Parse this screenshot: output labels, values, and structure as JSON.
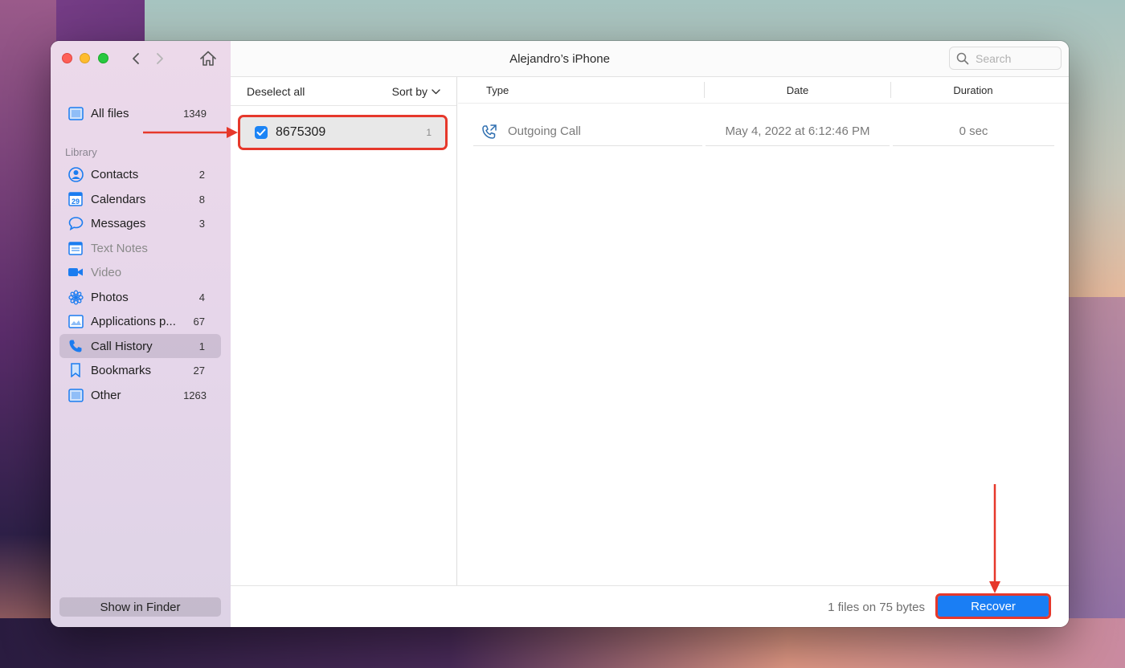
{
  "window": {
    "title": "Alejandro’s iPhone",
    "search_placeholder": "Search"
  },
  "sidebar": {
    "all_files": {
      "label": "All files",
      "count": "1349"
    },
    "section_label": "Library",
    "items": [
      {
        "label": "Contacts",
        "count": "2",
        "icon": "contacts-icon"
      },
      {
        "label": "Calendars",
        "count": "8",
        "icon": "calendar-icon"
      },
      {
        "label": "Messages",
        "count": "3",
        "icon": "messages-icon"
      },
      {
        "label": "Text Notes",
        "count": "",
        "icon": "notes-icon",
        "disabled": true
      },
      {
        "label": "Video",
        "count": "",
        "icon": "video-icon",
        "disabled": true
      },
      {
        "label": "Photos",
        "count": "4",
        "icon": "photos-icon"
      },
      {
        "label": "Applications p...",
        "count": "67",
        "icon": "applications-icon"
      },
      {
        "label": "Call History",
        "count": "1",
        "icon": "phone-icon",
        "active": true
      },
      {
        "label": "Bookmarks",
        "count": "27",
        "icon": "bookmark-icon"
      },
      {
        "label": "Other",
        "count": "1263",
        "icon": "other-icon"
      }
    ],
    "calendar_day": "29",
    "show_in_finder": "Show in Finder"
  },
  "middle": {
    "deselect_all": "Deselect all",
    "sort_by": "Sort by",
    "rows": [
      {
        "label": "8675309",
        "count": "1",
        "checked": true
      }
    ]
  },
  "table": {
    "columns": [
      "Type",
      "Date",
      "Duration"
    ],
    "rows": [
      {
        "type": "Outgoing Call",
        "date": "May 4, 2022 at 6:12:46 PM",
        "duration": "0 sec"
      }
    ]
  },
  "footer": {
    "info": "1 files on 75 bytes",
    "recover": "Recover"
  },
  "colors": {
    "accent": "#1a7ef4",
    "annotation": "#e6382b"
  }
}
